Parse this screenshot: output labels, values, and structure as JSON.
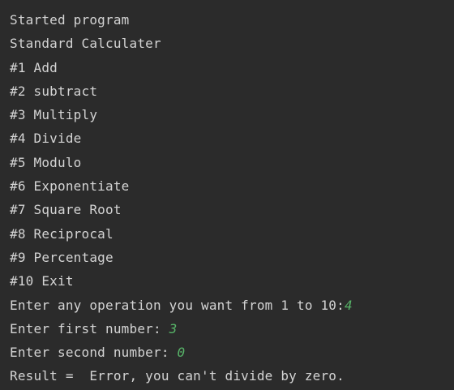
{
  "console": {
    "lines": [
      {
        "text": "Started program"
      },
      {
        "text": "Standard Calculater"
      },
      {
        "text": "#1 Add"
      },
      {
        "text": "#2 subtract"
      },
      {
        "text": "#3 Multiply"
      },
      {
        "text": "#4 Divide"
      },
      {
        "text": "#5 Modulo"
      },
      {
        "text": "#6 Exponentiate"
      },
      {
        "text": "#7 Square Root"
      },
      {
        "text": "#8 Reciprocal"
      },
      {
        "text": "#9 Percentage"
      },
      {
        "text": "#10 Exit"
      },
      {
        "text": "Enter any operation you want from 1 to 10:",
        "input": "4"
      },
      {
        "text": "Enter first number: ",
        "input": "3"
      },
      {
        "text": "Enter second number: ",
        "input": "0"
      },
      {
        "text": "Result =  Error, you can't divide by zero."
      }
    ]
  },
  "colors": {
    "background": "#2b2b2b",
    "output_text": "#d4d4d4",
    "user_input": "#57b368"
  }
}
